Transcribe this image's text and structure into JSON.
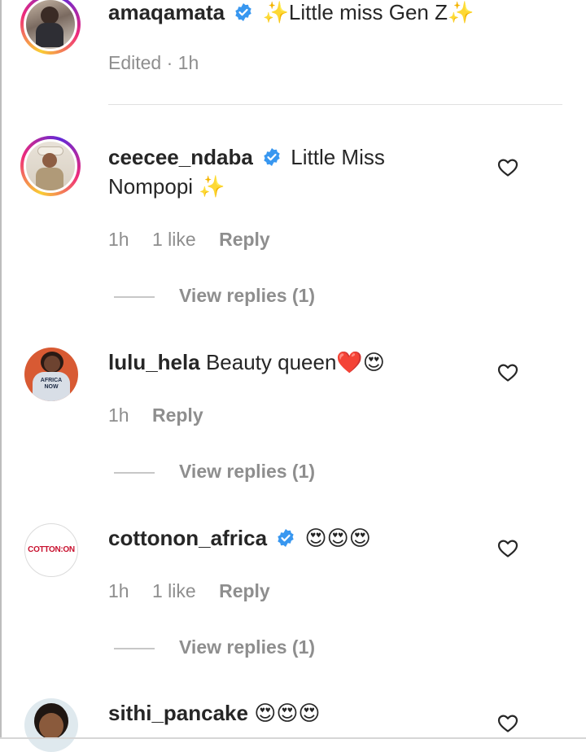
{
  "caption": {
    "username": "amaqamata",
    "sparkle_left": "✨",
    "text": "Little miss Gen Z",
    "sparkle_right": "✨",
    "edited_label": "Edited · 1h"
  },
  "comments": [
    {
      "username": "ceecee_ndaba",
      "verified": true,
      "text_line1": "Little Miss",
      "text_line2": "Nompopi",
      "emoji": "✨",
      "time": "1h",
      "likes": "1 like",
      "reply_label": "Reply",
      "view_replies": "View replies (1)"
    },
    {
      "username": "lulu_hela",
      "verified": false,
      "text": "Beauty queen",
      "emoji": "❤️😍",
      "time": "1h",
      "reply_label": "Reply",
      "view_replies": "View replies (1)"
    },
    {
      "username": "cottonon_africa",
      "verified": true,
      "avatar_text": "COTTON:ON",
      "emoji": "😍😍😍",
      "time": "1h",
      "likes": "1 like",
      "reply_label": "Reply",
      "view_replies": "View replies (1)"
    },
    {
      "username": "sithi_pancake",
      "verified": false,
      "emoji": "😍😍😍"
    }
  ],
  "colors": {
    "verified_blue": "#3897f0",
    "meta_gray": "#8e8e8e",
    "brand_red": "#c8102e"
  }
}
